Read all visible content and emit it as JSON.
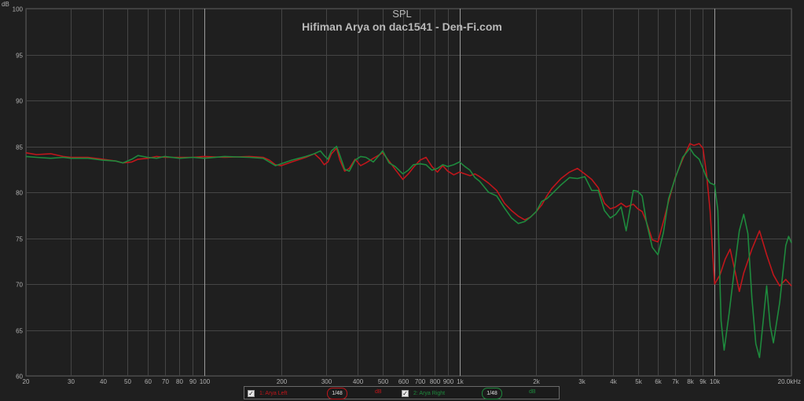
{
  "header": {
    "title": "SPL",
    "subtitle": "Hifiman Arya on dac1541 - Den-Fi.com",
    "y_unit": "dB"
  },
  "legend": {
    "items": [
      {
        "checked": true,
        "index_label": "1: Arya Left",
        "smoothing": "1/48",
        "unit": "dB",
        "color": "#c0161b"
      },
      {
        "checked": true,
        "index_label": "2: Arya Right",
        "smoothing": "1/48",
        "unit": "dB",
        "color": "#1e8a3d"
      }
    ]
  },
  "colors": {
    "background": "#1f1f1f",
    "grid": "#454545",
    "decade_grid": "#9a9a9a",
    "axis_text": "#b0b0b0",
    "left": "#c0161b",
    "right": "#1e8a3d"
  },
  "chart_data": {
    "type": "line",
    "title": "SPL",
    "subtitle": "Hifiman Arya on dac1541 - Den-Fi.com",
    "ylabel": "dB",
    "xlabel": "",
    "x_scale": "log",
    "xlim": [
      20,
      20000
    ],
    "ylim": [
      60,
      100
    ],
    "grid": true,
    "legend_position": "bottom",
    "x_ticks": [
      {
        "v": 20,
        "label": "20"
      },
      {
        "v": 30,
        "label": "30"
      },
      {
        "v": 40,
        "label": "40"
      },
      {
        "v": 50,
        "label": "50"
      },
      {
        "v": 60,
        "label": "60"
      },
      {
        "v": 70,
        "label": "70"
      },
      {
        "v": 80,
        "label": "80"
      },
      {
        "v": 90,
        "label": "90"
      },
      {
        "v": 100,
        "label": "100"
      },
      {
        "v": 200,
        "label": "200"
      },
      {
        "v": 300,
        "label": "300"
      },
      {
        "v": 400,
        "label": "400"
      },
      {
        "v": 500,
        "label": "500"
      },
      {
        "v": 600,
        "label": "600"
      },
      {
        "v": 700,
        "label": "700"
      },
      {
        "v": 800,
        "label": "800"
      },
      {
        "v": 900,
        "label": "900"
      },
      {
        "v": 1000,
        "label": "1k"
      },
      {
        "v": 2000,
        "label": "2k"
      },
      {
        "v": 3000,
        "label": "3k"
      },
      {
        "v": 4000,
        "label": "4k"
      },
      {
        "v": 5000,
        "label": "5k"
      },
      {
        "v": 6000,
        "label": "6k"
      },
      {
        "v": 7000,
        "label": "7k"
      },
      {
        "v": 8000,
        "label": "8k"
      },
      {
        "v": 9000,
        "label": "9k"
      },
      {
        "v": 10000,
        "label": "10k"
      },
      {
        "v": 20000,
        "label": "20.0kHz"
      }
    ],
    "y_ticks": [
      60,
      65,
      70,
      75,
      80,
      85,
      90,
      95,
      100
    ],
    "series": [
      {
        "name": "Arya Left",
        "color": "#c0161b",
        "points": [
          [
            20,
            84.3
          ],
          [
            22,
            84.1
          ],
          [
            25,
            84.2
          ],
          [
            28,
            83.9
          ],
          [
            30,
            83.8
          ],
          [
            35,
            83.8
          ],
          [
            40,
            83.6
          ],
          [
            45,
            83.4
          ],
          [
            48,
            83.2
          ],
          [
            52,
            83.3
          ],
          [
            55,
            83.6
          ],
          [
            60,
            83.7
          ],
          [
            65,
            83.9
          ],
          [
            70,
            83.8
          ],
          [
            80,
            83.8
          ],
          [
            90,
            83.8
          ],
          [
            100,
            83.9
          ],
          [
            120,
            83.8
          ],
          [
            150,
            83.9
          ],
          [
            170,
            83.8
          ],
          [
            180,
            83.5
          ],
          [
            190,
            83.0
          ],
          [
            200,
            82.9
          ],
          [
            220,
            83.3
          ],
          [
            250,
            83.8
          ],
          [
            270,
            84.2
          ],
          [
            285,
            83.6
          ],
          [
            295,
            83.0
          ],
          [
            305,
            83.3
          ],
          [
            315,
            84.2
          ],
          [
            330,
            84.8
          ],
          [
            340,
            83.5
          ],
          [
            355,
            82.3
          ],
          [
            370,
            82.6
          ],
          [
            390,
            83.6
          ],
          [
            410,
            82.9
          ],
          [
            430,
            83.2
          ],
          [
            460,
            83.7
          ],
          [
            480,
            84.0
          ],
          [
            500,
            84.3
          ],
          [
            530,
            83.4
          ],
          [
            560,
            82.5
          ],
          [
            600,
            81.4
          ],
          [
            630,
            82.0
          ],
          [
            660,
            82.7
          ],
          [
            700,
            83.5
          ],
          [
            740,
            83.8
          ],
          [
            780,
            82.8
          ],
          [
            820,
            82.2
          ],
          [
            860,
            82.9
          ],
          [
            900,
            82.3
          ],
          [
            950,
            81.9
          ],
          [
            1000,
            82.2
          ],
          [
            1050,
            82.0
          ],
          [
            1100,
            81.8
          ],
          [
            1150,
            82.0
          ],
          [
            1200,
            81.7
          ],
          [
            1300,
            81.0
          ],
          [
            1400,
            80.2
          ],
          [
            1500,
            78.8
          ],
          [
            1600,
            78.0
          ],
          [
            1700,
            77.4
          ],
          [
            1800,
            77.0
          ],
          [
            1900,
            77.3
          ],
          [
            2000,
            77.9
          ],
          [
            2100,
            78.6
          ],
          [
            2200,
            79.6
          ],
          [
            2300,
            80.4
          ],
          [
            2500,
            81.5
          ],
          [
            2700,
            82.2
          ],
          [
            2900,
            82.6
          ],
          [
            3100,
            82.0
          ],
          [
            3300,
            81.4
          ],
          [
            3500,
            80.5
          ],
          [
            3700,
            78.8
          ],
          [
            3900,
            78.2
          ],
          [
            4100,
            78.4
          ],
          [
            4300,
            78.8
          ],
          [
            4500,
            78.4
          ],
          [
            4800,
            78.7
          ],
          [
            5000,
            78.2
          ],
          [
            5200,
            77.9
          ],
          [
            5400,
            76.8
          ],
          [
            5700,
            74.8
          ],
          [
            6000,
            74.6
          ],
          [
            6300,
            76.8
          ],
          [
            6600,
            79.0
          ],
          [
            7000,
            81.6
          ],
          [
            7500,
            83.6
          ],
          [
            8000,
            85.3
          ],
          [
            8300,
            85.1
          ],
          [
            8700,
            85.3
          ],
          [
            9000,
            84.8
          ],
          [
            9300,
            82.0
          ],
          [
            9600,
            78.0
          ],
          [
            10000,
            70.0
          ],
          [
            10500,
            71.0
          ],
          [
            11000,
            72.7
          ],
          [
            11500,
            73.8
          ],
          [
            12000,
            71.5
          ],
          [
            12500,
            69.2
          ],
          [
            13000,
            71.2
          ],
          [
            14000,
            73.8
          ],
          [
            15000,
            75.8
          ],
          [
            16000,
            73.2
          ],
          [
            17000,
            71.0
          ],
          [
            18000,
            69.8
          ],
          [
            19000,
            70.5
          ],
          [
            20000,
            69.8
          ]
        ]
      },
      {
        "name": "Arya Right",
        "color": "#1e8a3d",
        "points": [
          [
            20,
            83.9
          ],
          [
            22,
            83.8
          ],
          [
            25,
            83.7
          ],
          [
            28,
            83.8
          ],
          [
            30,
            83.7
          ],
          [
            35,
            83.7
          ],
          [
            40,
            83.5
          ],
          [
            45,
            83.4
          ],
          [
            48,
            83.2
          ],
          [
            52,
            83.6
          ],
          [
            55,
            84.0
          ],
          [
            60,
            83.8
          ],
          [
            65,
            83.7
          ],
          [
            70,
            83.9
          ],
          [
            80,
            83.7
          ],
          [
            90,
            83.8
          ],
          [
            100,
            83.7
          ],
          [
            120,
            83.9
          ],
          [
            150,
            83.8
          ],
          [
            170,
            83.7
          ],
          [
            180,
            83.3
          ],
          [
            190,
            82.9
          ],
          [
            200,
            83.1
          ],
          [
            220,
            83.5
          ],
          [
            250,
            83.9
          ],
          [
            270,
            84.2
          ],
          [
            285,
            84.5
          ],
          [
            295,
            84.0
          ],
          [
            305,
            83.6
          ],
          [
            315,
            84.5
          ],
          [
            330,
            85.0
          ],
          [
            340,
            84.0
          ],
          [
            355,
            82.5
          ],
          [
            370,
            82.3
          ],
          [
            390,
            83.5
          ],
          [
            410,
            83.9
          ],
          [
            430,
            83.8
          ],
          [
            460,
            83.3
          ],
          [
            480,
            83.9
          ],
          [
            500,
            84.5
          ],
          [
            530,
            83.2
          ],
          [
            560,
            82.8
          ],
          [
            600,
            82.0
          ],
          [
            630,
            82.4
          ],
          [
            660,
            83.0
          ],
          [
            700,
            83.1
          ],
          [
            740,
            83.0
          ],
          [
            780,
            82.4
          ],
          [
            820,
            82.6
          ],
          [
            860,
            83.0
          ],
          [
            900,
            82.8
          ],
          [
            950,
            83.0
          ],
          [
            1000,
            83.3
          ],
          [
            1050,
            82.8
          ],
          [
            1100,
            82.4
          ],
          [
            1150,
            81.6
          ],
          [
            1200,
            81.2
          ],
          [
            1300,
            80.0
          ],
          [
            1400,
            79.6
          ],
          [
            1500,
            78.3
          ],
          [
            1600,
            77.2
          ],
          [
            1700,
            76.6
          ],
          [
            1800,
            76.8
          ],
          [
            1900,
            77.3
          ],
          [
            2000,
            77.9
          ],
          [
            2100,
            79.0
          ],
          [
            2200,
            79.3
          ],
          [
            2300,
            79.8
          ],
          [
            2500,
            80.8
          ],
          [
            2700,
            81.6
          ],
          [
            2900,
            81.5
          ],
          [
            3100,
            81.7
          ],
          [
            3300,
            80.2
          ],
          [
            3500,
            80.2
          ],
          [
            3700,
            78.0
          ],
          [
            3900,
            77.2
          ],
          [
            4100,
            77.6
          ],
          [
            4300,
            78.4
          ],
          [
            4500,
            75.8
          ],
          [
            4800,
            80.2
          ],
          [
            5000,
            80.1
          ],
          [
            5200,
            79.6
          ],
          [
            5400,
            76.8
          ],
          [
            5700,
            74.0
          ],
          [
            6000,
            73.2
          ],
          [
            6300,
            75.6
          ],
          [
            6600,
            79.3
          ],
          [
            7000,
            81.5
          ],
          [
            7500,
            83.8
          ],
          [
            8000,
            84.8
          ],
          [
            8300,
            84.1
          ],
          [
            8700,
            83.6
          ],
          [
            9000,
            82.6
          ],
          [
            9300,
            81.6
          ],
          [
            9600,
            81.0
          ],
          [
            10000,
            80.8
          ],
          [
            10300,
            78.0
          ],
          [
            10600,
            66.0
          ],
          [
            10900,
            62.8
          ],
          [
            11400,
            66.8
          ],
          [
            12000,
            72.0
          ],
          [
            12500,
            75.8
          ],
          [
            13000,
            77.6
          ],
          [
            13500,
            75.5
          ],
          [
            14000,
            68.5
          ],
          [
            14500,
            63.5
          ],
          [
            15000,
            62.0
          ],
          [
            15500,
            66.0
          ],
          [
            16000,
            69.8
          ],
          [
            16500,
            65.5
          ],
          [
            17000,
            63.6
          ],
          [
            18000,
            68.0
          ],
          [
            19000,
            74.2
          ],
          [
            19500,
            75.2
          ],
          [
            20000,
            74.5
          ]
        ]
      }
    ]
  }
}
